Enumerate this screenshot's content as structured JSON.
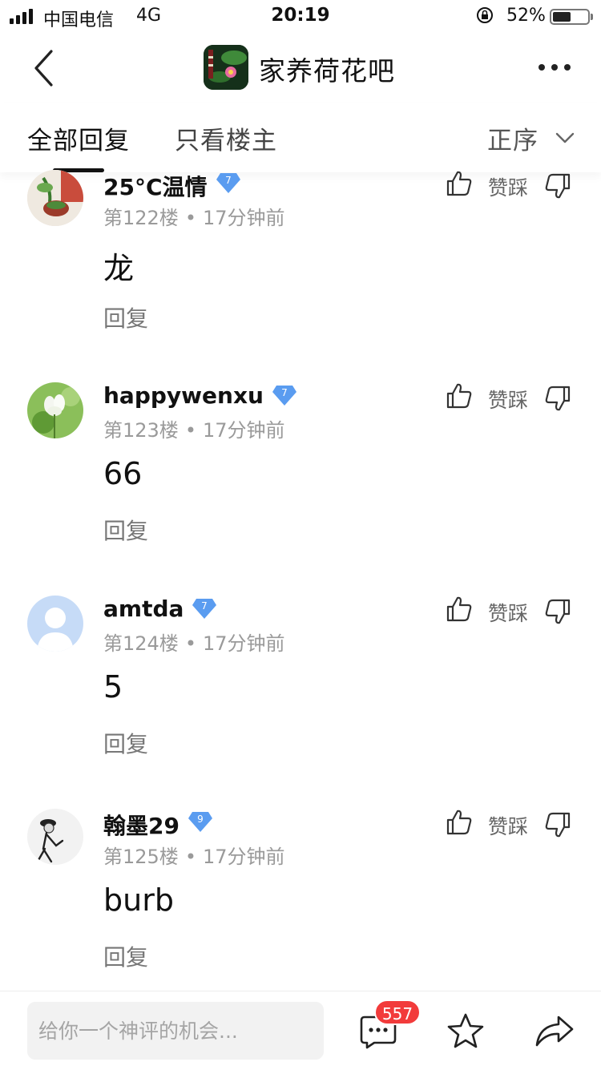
{
  "status_bar": {
    "carrier": "中国电信",
    "network": "4G",
    "time": "20:19",
    "battery_text": "52%",
    "battery_level": 0.52
  },
  "header": {
    "title": "家养荷花吧",
    "logo_icon": "lotus-forum-logo"
  },
  "tabs": {
    "all": "全部回复",
    "owner_only": "只看楼主",
    "sort": "正序"
  },
  "replies": [
    {
      "username": "25°C温情",
      "level": "7",
      "floor": "第122楼",
      "time": "17分钟前",
      "content": "龙",
      "reply_label": "回复",
      "vote_label": "赞踩",
      "avatar_icon": "avatar-plant-pot"
    },
    {
      "username": "happywenxu",
      "level": "7",
      "floor": "第123楼",
      "time": "17分钟前",
      "content": "66",
      "reply_label": "回复",
      "vote_label": "赞踩",
      "avatar_icon": "avatar-lotus-flower"
    },
    {
      "username": "amtda",
      "level": "7",
      "floor": "第124楼",
      "time": "17分钟前",
      "content": "5",
      "reply_label": "回复",
      "vote_label": "赞踩",
      "avatar_icon": "avatar-default-person"
    },
    {
      "username": "翰墨29",
      "level": "9",
      "floor": "第125楼",
      "time": "17分钟前",
      "content": "burb",
      "reply_label": "回复",
      "vote_label": "赞踩",
      "avatar_icon": "avatar-sketch-figure"
    }
  ],
  "bottom_bar": {
    "input_placeholder": "给你一个神评的机会...",
    "comment_count": "557"
  },
  "colors": {
    "badge_red": "#f23b3b",
    "level_badge_blue": "#5a9cf0",
    "text_primary": "#111111",
    "text_meta": "#9a9a9a"
  }
}
